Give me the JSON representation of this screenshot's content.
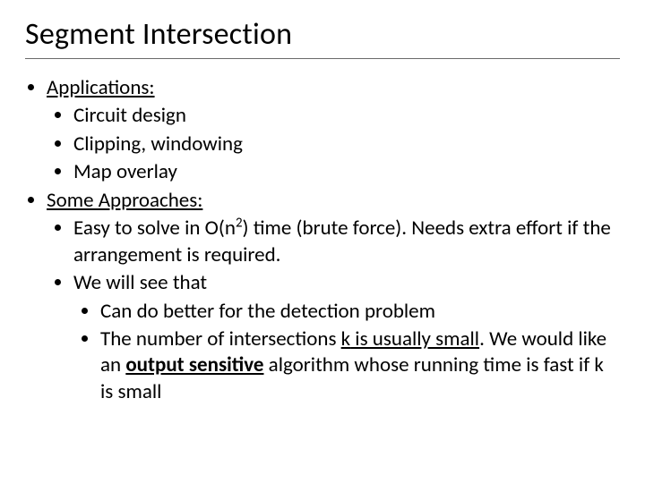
{
  "title": "Segment Intersection",
  "bullets": {
    "apps_heading": "Applications:",
    "app1": "Circuit design",
    "app2": "Clipping, windowing",
    "app3": "Map overlay",
    "approaches_heading": "Some Approaches:",
    "brute1a": "Easy to solve in O(n",
    "brute1b": ") time (brute force). Needs extra effort if the arrangement is required.",
    "wewill": "We will see that",
    "detect": "Can do better for the detection problem",
    "k1": "The number of intersections ",
    "k_var": "k",
    "k2": " is usually small",
    "k3": ". We would like an ",
    "k_out": "output sensitive",
    "k4": " algorithm whose running time is fast if k is small"
  }
}
